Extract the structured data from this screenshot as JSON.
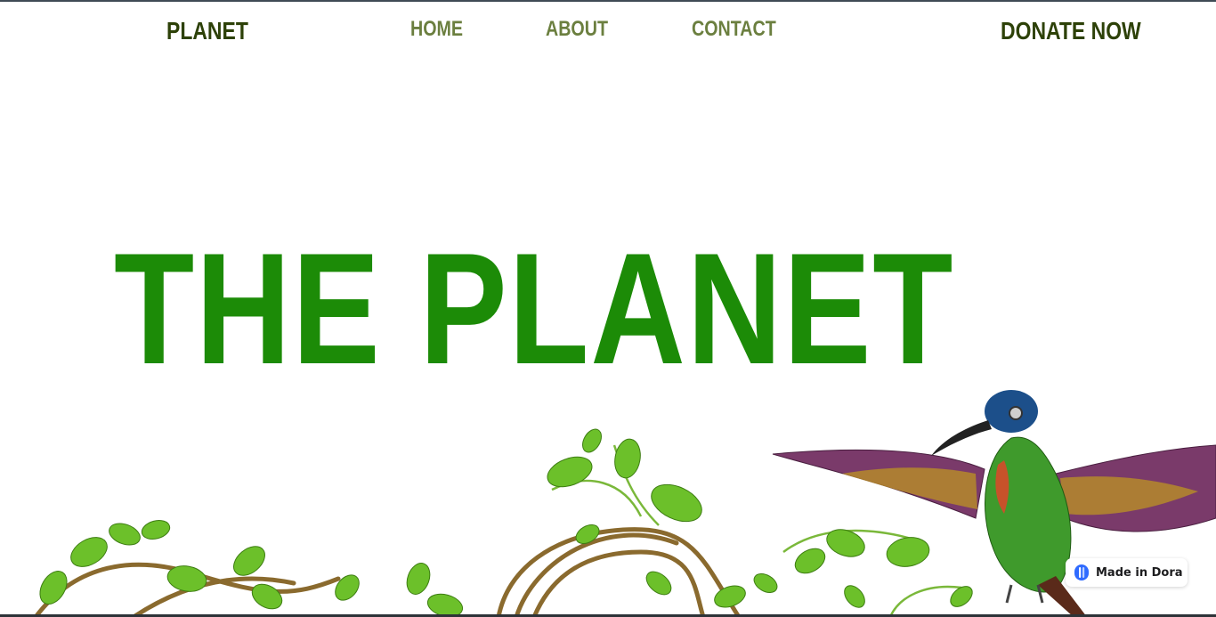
{
  "header": {
    "logo": "PLANET",
    "nav": {
      "home": "HOME",
      "about": "ABOUT",
      "contact": "CONTACT"
    },
    "donate": "DONATE NOW"
  },
  "hero": {
    "title": "THE PLANET"
  },
  "badge": {
    "label": "Made in Dora",
    "icon": "dora-logo-icon"
  },
  "colors": {
    "logo": "#2d4108",
    "nav": "#6b7f3f",
    "hero": "#1c8b07",
    "leaf": "#6cc02a",
    "vine": "#8a6a2e"
  },
  "images": {
    "vines": "green-vines-illustration",
    "bird": "hummingbird-illustration"
  }
}
